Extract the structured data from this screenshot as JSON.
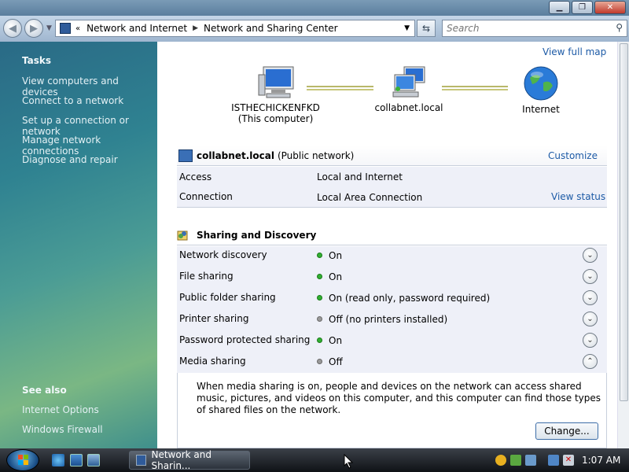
{
  "nav": {
    "breadcrumb_root": "Network and Internet",
    "breadcrumb_current": "Network and Sharing Center",
    "search_placeholder": "Search"
  },
  "sidebar": {
    "tasks_title": "Tasks",
    "tasks": [
      "View computers and devices",
      "Connect to a network",
      "Set up a connection or network",
      "Manage network connections",
      "Diagnose and repair"
    ],
    "see_also_title": "See also",
    "see_also": [
      "Internet Options",
      "Windows Firewall"
    ]
  },
  "map": {
    "view_full_map": "View full map",
    "computer_name": "ISTHECHICKENFKD",
    "computer_sub": "(This computer)",
    "network_name": "collabnet.local",
    "internet_label": "Internet"
  },
  "network": {
    "name": "collabnet.local",
    "type": "(Public network)",
    "customize": "Customize",
    "access_label": "Access",
    "access_value": "Local and Internet",
    "connection_label": "Connection",
    "connection_value": "Local Area Connection",
    "view_status": "View status"
  },
  "sharing": {
    "title": "Sharing and Discovery",
    "items": [
      {
        "label": "Network discovery",
        "value": "On",
        "status": "on"
      },
      {
        "label": "File sharing",
        "value": "On",
        "status": "on"
      },
      {
        "label": "Public folder sharing",
        "value": "On (read only, password required)",
        "status": "on"
      },
      {
        "label": "Printer sharing",
        "value": "Off (no printers installed)",
        "status": "off"
      },
      {
        "label": "Password protected sharing",
        "value": "On",
        "status": "on"
      },
      {
        "label": "Media sharing",
        "value": "Off",
        "status": "off"
      }
    ],
    "media_description": "When media sharing is on, people and devices on the network can access shared music, pictures, and videos on this computer, and this computer can find those types of shared files on the network.",
    "change_button": "Change..."
  },
  "taskbar": {
    "active_window": "Network and Sharin...",
    "clock": "1:07 AM"
  },
  "colors": {
    "link": "#1c5aa6",
    "status_on": "#32b032",
    "status_off": "#9a9a9a"
  }
}
